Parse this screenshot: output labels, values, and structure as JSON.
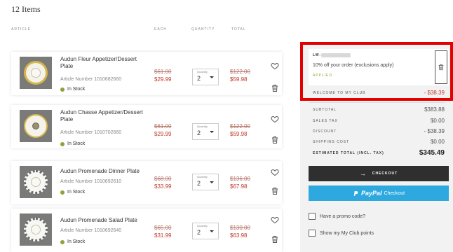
{
  "header": {
    "items_count": "12 Items"
  },
  "columns": {
    "article": "ARTICLE",
    "each": "EACH",
    "quantity": "QUANTITY",
    "total": "TOTAL"
  },
  "items": [
    {
      "name": "Audun Fleur Appetizer/Dessert Plate",
      "article": "Article Number 1010682660",
      "stock": "In Stock",
      "old_price": "$61.00",
      "price": "$29.99",
      "qty_label": "Quantity",
      "qty": "2",
      "old_total": "$122.00",
      "total": "$59.98",
      "thumb_style": "gold"
    },
    {
      "name": "Audun Chasse Appetizer/Dessert Plate",
      "article": "Article Number 1010702660",
      "stock": "In Stock",
      "old_price": "$61.00",
      "price": "$29.99",
      "qty_label": "Quantity",
      "qty": "2",
      "old_total": "$122.00",
      "total": "$59.98",
      "thumb_style": "gold-dot"
    },
    {
      "name": "Audun Promenade Dinner Plate",
      "article": "Article Number 1010692610",
      "stock": "In Stock",
      "old_price": "$68.00",
      "price": "$33.99",
      "qty_label": "Quantity",
      "qty": "2",
      "old_total": "$136.00",
      "total": "$67.98",
      "thumb_style": "pattern"
    },
    {
      "name": "Audun Promenade Salad Plate",
      "article": "Article Number 1010692640",
      "stock": "In Stock",
      "old_price": "$65.00",
      "price": "$31.99",
      "qty_label": "Quantity",
      "qty": "2",
      "old_total": "$130.00",
      "total": "$63.98",
      "thumb_style": "pattern"
    }
  ],
  "coupon": {
    "code_prefix": "LW-",
    "description": "10% off your order (exclusions apply)",
    "status": "APPLIED"
  },
  "welcome": {
    "label": "WELCOME TO MY CLUB",
    "value": "- $38.39"
  },
  "summary": {
    "subtotal_label": "SUBTOTAL",
    "subtotal": "$383.88",
    "tax_label": "SALES TAX",
    "tax": "$0.00",
    "discount_label": "DISCOUNT",
    "discount": "- $38.39",
    "shipping_label": "SHIPPING COST",
    "shipping": "$0.00",
    "total_label": "ESTIMATED TOTAL (INCL. TAX)",
    "total": "$345.49"
  },
  "buttons": {
    "checkout": "CHECKOUT",
    "paypal_brand": "PayPal",
    "paypal_text": "Checkout"
  },
  "options": {
    "promo": "Have a promo code?",
    "club_points": "Show my My Club points"
  },
  "colors": {
    "sale_red": "#c0392b",
    "stock_green": "#8aa43a",
    "checkout_dark": "#2f2f2f",
    "paypal_blue": "#2ea9df",
    "highlight_red": "#e30000"
  }
}
